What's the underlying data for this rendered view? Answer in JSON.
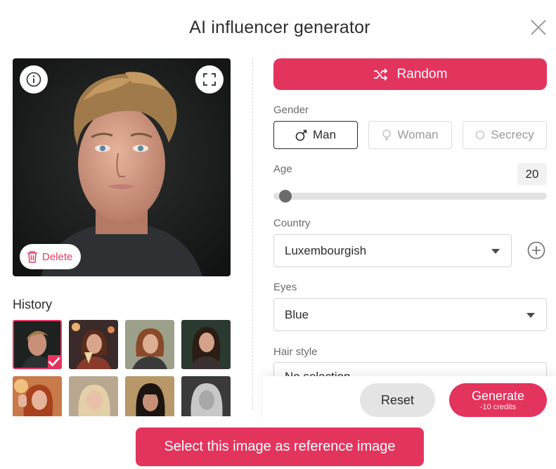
{
  "dialog": {
    "title": "AI influencer generator",
    "close_icon": "close-icon"
  },
  "preview": {
    "info_icon": "info-icon",
    "expand_icon": "expand-icon",
    "delete_label": "Delete",
    "delete_icon": "trash-icon"
  },
  "history": {
    "label": "History",
    "selected_index": 0,
    "count_visible": 8
  },
  "controls": {
    "random_label": "Random",
    "random_icon": "shuffle-icon",
    "gender": {
      "label": "Gender",
      "options": [
        {
          "label": "Man",
          "icon": "male-icon",
          "selected": true
        },
        {
          "label": "Woman",
          "icon": "female-icon",
          "selected": false
        },
        {
          "label": "Secrecy",
          "icon": "circle-icon",
          "selected": false
        }
      ]
    },
    "age": {
      "label": "Age",
      "value": "20"
    },
    "country": {
      "label": "Country",
      "value": "Luxembourgish",
      "add_icon": "plus-circle-icon"
    },
    "eyes": {
      "label": "Eyes",
      "value": "Blue"
    },
    "hair_style": {
      "label": "Hair style",
      "value": "No selection"
    }
  },
  "footer": {
    "reset_label": "Reset",
    "generate_label": "Generate",
    "generate_cost": "-10 credits",
    "reference_label": "Select this image as reference image"
  },
  "colors": {
    "accent": "#e3345e",
    "neutral_button": "#e4e4e4",
    "border": "#d6d6d6"
  }
}
